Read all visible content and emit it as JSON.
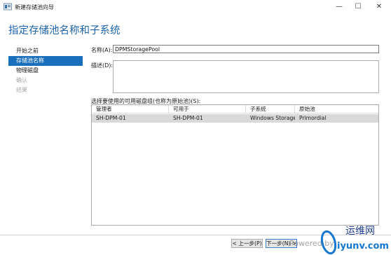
{
  "window": {
    "title": "新建存储池向导",
    "controls": {
      "minimize": "—",
      "maximize": "☐",
      "close": "✕"
    }
  },
  "header": {
    "title": "指定存储池名称和子系统"
  },
  "nav": {
    "items": [
      {
        "label": "开始之前",
        "state": "normal"
      },
      {
        "label": "存储池名称",
        "state": "active"
      },
      {
        "label": "物理磁盘",
        "state": "normal"
      },
      {
        "label": "确认",
        "state": "disabled"
      },
      {
        "label": "结果",
        "state": "disabled"
      }
    ]
  },
  "form": {
    "name_label": "名称(A):",
    "name_value": "DPMStoragePool",
    "desc_label": "描述(D):",
    "desc_value": "",
    "group_label": "选择要使用的可用磁盘组(也称为原始池)(S):"
  },
  "table": {
    "columns": [
      "管理者",
      "可用于",
      "子系统",
      "原始池"
    ],
    "rows": [
      [
        "SH-DPM-01",
        "SH-DPM-01",
        "Windows Storage",
        "Primordial"
      ]
    ]
  },
  "buttons": {
    "prev": "< 上一步(P)",
    "next": "下一步(N) >"
  },
  "watermark": {
    "text": "Powered by",
    "logo_top": "运维网",
    "logo_bottom": "iyunv.com"
  },
  "colors": {
    "accent": "#1a6fbd",
    "title": "#1c63a8",
    "selected_row": "#d9d9d9",
    "disabled": "#a8a8a8"
  }
}
